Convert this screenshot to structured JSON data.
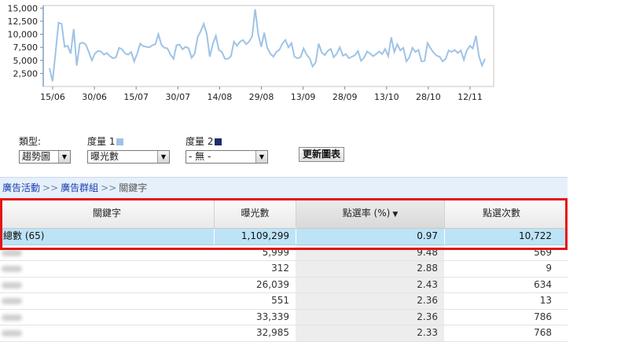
{
  "chart_data": {
    "type": "line",
    "x_tick_labels": [
      "15/06",
      "30/06",
      "15/07",
      "30/07",
      "14/08",
      "29/08",
      "13/09",
      "28/09",
      "13/10",
      "28/10",
      "12/11"
    ],
    "y_tick_labels": [
      "2,500",
      "5,000",
      "7,500",
      "10,000",
      "12,500",
      "15,000"
    ],
    "ylim": [
      0,
      15500
    ],
    "series_color": "#9ec3e6",
    "values": [
      3500,
      1000,
      6500,
      12200,
      12000,
      7600,
      7800,
      6300,
      11000,
      4000,
      8200,
      8400,
      8000,
      6600,
      5000,
      6300,
      6800,
      6700,
      6100,
      6400,
      5800,
      5400,
      5600,
      7400,
      7100,
      6300,
      6100,
      6600,
      4800,
      6300,
      8200,
      7700,
      7600,
      7500,
      7900,
      8100,
      10000,
      8000,
      7400,
      7300,
      6100,
      5300,
      7900,
      8000,
      7100,
      7600,
      7300,
      5500,
      6300,
      9500,
      10600,
      12000,
      10000,
      5700,
      8200,
      9700,
      7000,
      6600,
      5300,
      5300,
      5800,
      8600,
      7800,
      8600,
      8900,
      8100,
      8600,
      9600,
      14800,
      10000,
      7600,
      10300,
      7400,
      6300,
      5700,
      6600,
      7000,
      8200,
      8900,
      7500,
      8300,
      5700,
      5400,
      5600,
      7300,
      6100,
      5400,
      3800,
      4600,
      8200,
      6500,
      6000,
      6800,
      7200,
      5600,
      6300,
      7500,
      5900,
      6200,
      5400,
      5700,
      6000,
      6800,
      4900,
      5500,
      6700,
      6300,
      5800,
      6200,
      6700,
      6200,
      7200,
      5800,
      9400,
      6600,
      8100,
      6900,
      7400,
      4800,
      5600,
      7400,
      6600,
      7000,
      4800,
      4900,
      8300,
      7300,
      6500,
      5900,
      5700,
      4800,
      5300,
      6900,
      6600,
      7000,
      6400,
      6900,
      5100,
      6900,
      7800,
      7300,
      9700,
      5800,
      4000,
      5300
    ]
  },
  "controls": {
    "type_label": "類型:",
    "type_value": "趨勢圖",
    "metric1_label": "度量 1",
    "metric1_value": "曝光數",
    "metric1_color": "#9ec3e6",
    "metric2_label": "度量 2",
    "metric2_value": "- 無 -",
    "metric2_color": "#1f2d6b",
    "update_button": "更新圖表"
  },
  "breadcrumb": {
    "campaign": "廣告活動",
    "ad_group": "廣告群組",
    "separator": ">>",
    "current": "關鍵字"
  },
  "table": {
    "headers": {
      "keyword": "關鍵字",
      "impressions": "曝光數",
      "ctr": "點選率 (%)",
      "clicks": "點選次數"
    },
    "sort_indicator": "▼",
    "total": {
      "keyword": "總數 (65)",
      "impressions": "1,109,299",
      "ctr": "0.97",
      "clicks": "10,722"
    },
    "rows": [
      {
        "impressions": "5,999",
        "ctr": "9.48",
        "clicks": "569"
      },
      {
        "impressions": "312",
        "ctr": "2.88",
        "clicks": "9"
      },
      {
        "impressions": "26,039",
        "ctr": "2.43",
        "clicks": "634"
      },
      {
        "impressions": "551",
        "ctr": "2.36",
        "clicks": "13"
      },
      {
        "impressions": "33,339",
        "ctr": "2.36",
        "clicks": "786"
      },
      {
        "impressions": "32,985",
        "ctr": "2.33",
        "clicks": "768"
      }
    ]
  },
  "colors": {
    "highlight": "#e41515",
    "total_row": "#bde3f7",
    "link": "#1a3fb0"
  }
}
